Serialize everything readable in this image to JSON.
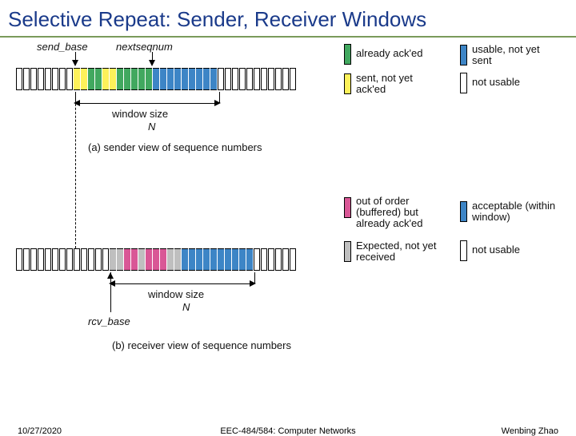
{
  "title": "Selective Repeat: Sender, Receiver Windows",
  "sender": {
    "send_base_label": "send_base",
    "nextseqnum_label": "nextseqnum",
    "window_label": "window size",
    "window_var": "N",
    "caption": "(a) sender view of sequence numbers",
    "legend": {
      "ack": "already ack'ed",
      "sent": "sent, not yet ack'ed",
      "usable": "usable, not yet sent",
      "notusable": "not usable"
    }
  },
  "receiver": {
    "rcv_base_label": "rcv_base",
    "window_label": "window size",
    "window_var": "N",
    "caption": "(b) receiver view of sequence numbers",
    "legend": {
      "buffered": "out of order (buffered) but already ack'ed",
      "expected": "Expected, not yet received",
      "acceptable": "acceptable (within window)",
      "notusable": "not usable"
    }
  },
  "footer": {
    "date": "10/27/2020",
    "course": "EEC-484/584: Computer Networks",
    "author": "Wenbing Zhao"
  }
}
